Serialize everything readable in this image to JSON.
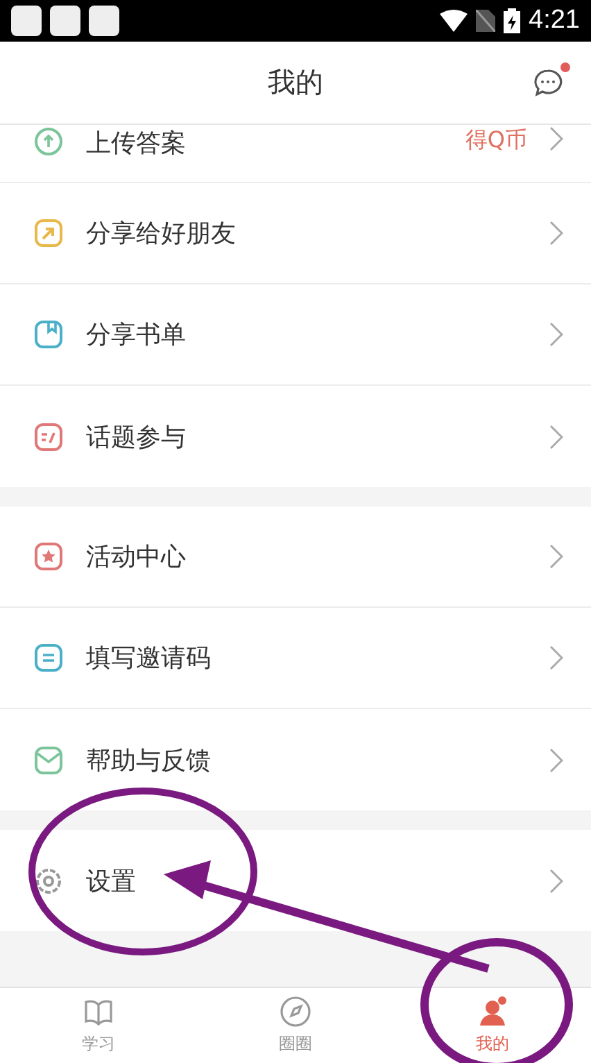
{
  "status_bar": {
    "time": "4:21"
  },
  "header": {
    "title": "我的",
    "message_badge": true
  },
  "sections": [
    [
      {
        "label": "上传答案",
        "kind": "upload",
        "color": "#7cc49a",
        "note": "得Q币",
        "cut_off": true
      },
      {
        "label": "分享给好朋友",
        "kind": "share",
        "color": "#e8b84a"
      },
      {
        "label": "分享书单",
        "kind": "book",
        "color": "#4ab0c8"
      },
      {
        "label": "话题参与",
        "kind": "topic",
        "color": "#e07878"
      }
    ],
    [
      {
        "label": "活动中心",
        "kind": "star",
        "color": "#e07878"
      },
      {
        "label": "填写邀请码",
        "kind": "code",
        "color": "#4ab0c8"
      },
      {
        "label": "帮助与反馈",
        "kind": "mail",
        "color": "#7cc49a"
      }
    ],
    [
      {
        "label": "设置",
        "kind": "gear",
        "color": "#999999"
      }
    ]
  ],
  "tab_bar": [
    {
      "label": "学习",
      "kind": "book",
      "selected": false
    },
    {
      "label": "圈圈",
      "kind": "compass",
      "selected": false
    },
    {
      "label": "我的",
      "kind": "person",
      "selected": true
    }
  ]
}
